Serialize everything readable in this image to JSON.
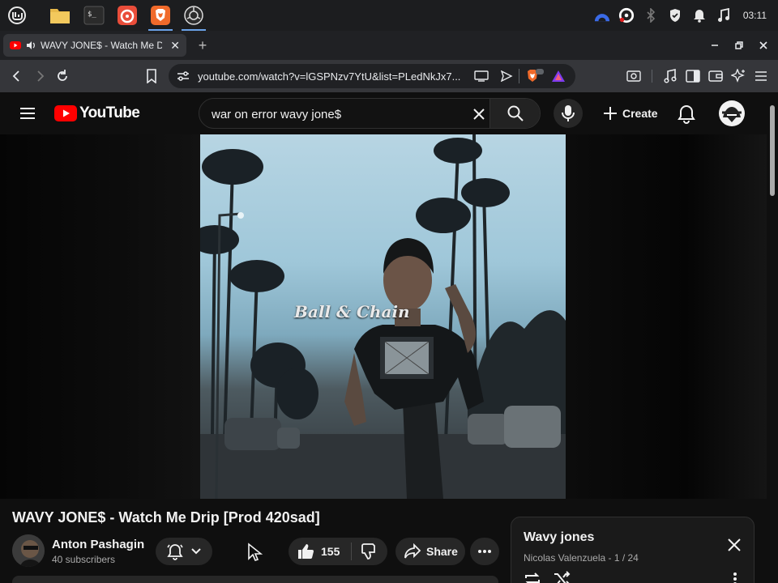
{
  "taskbar": {
    "apps": [
      "mint-menu-icon",
      "files-icon",
      "terminal-icon",
      "firefox-icon",
      "brave-icon",
      "obs-icon"
    ],
    "clock": "03:11"
  },
  "browser": {
    "tab_title": "WAVY JONE$ - Watch Me D",
    "url": "youtube.com/watch?v=lGSPNzv7YtU&list=PLedNkJx7..."
  },
  "youtube": {
    "brand": "YouTube",
    "search_value": "war on error wavy jone$",
    "create_label": "Create",
    "video": {
      "overlay_text": "Ball & Chain",
      "title": "WAVY JONE$ - Watch Me Drip [Prod 420sad]",
      "channel_name": "Anton Pashagin",
      "subscribers": "40 subscribers",
      "likes": "155",
      "share_label": "Share"
    },
    "playlist": {
      "title": "Wavy jones",
      "subtitle": "Nicolas Valenzuela - 1 / 24"
    }
  },
  "colors": {
    "youtube_red": "#ff0000",
    "page_bg": "#0f0f0f",
    "chrome_toolbar": "#35363a"
  }
}
